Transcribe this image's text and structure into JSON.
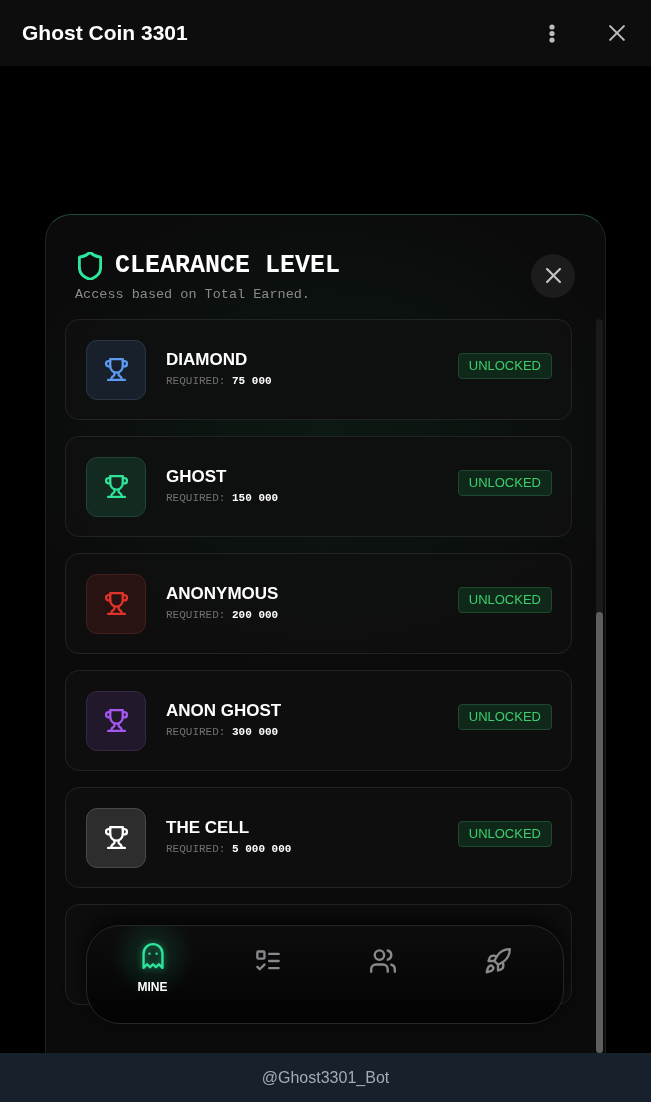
{
  "app_bar": {
    "title": "Ghost Coin 3301"
  },
  "modal": {
    "title": "CLEARANCE LEVEL",
    "subtitle": "Access based on Total Earned.",
    "levels": [
      {
        "name": "DIAMOND",
        "required_label": "REQUIRED:",
        "required": "75 000",
        "status": "UNLOCKED",
        "color": "#5b9cf2"
      },
      {
        "name": "GHOST",
        "required_label": "REQUIRED:",
        "required": "150 000",
        "status": "UNLOCKED",
        "color": "#2fe39a"
      },
      {
        "name": "ANONYMOUS",
        "required_label": "REQUIRED:",
        "required": "200 000",
        "status": "UNLOCKED",
        "color": "#e0342a"
      },
      {
        "name": "ANON GHOST",
        "required_label": "REQUIRED:",
        "required": "300 000",
        "status": "UNLOCKED",
        "color": "#a558f0"
      },
      {
        "name": "THE CELL",
        "required_label": "REQUIRED:",
        "required": "5 000 000",
        "status": "UNLOCKED",
        "color": "#ffffff"
      }
    ]
  },
  "bottom_nav": [
    {
      "kind": "ghost",
      "label": "MINE",
      "selected": true
    },
    {
      "kind": "checklist",
      "selected": false
    },
    {
      "kind": "users",
      "selected": false
    },
    {
      "kind": "rocket",
      "selected": false
    }
  ],
  "footer": {
    "bot_name": "@Ghost3301_Bot"
  }
}
